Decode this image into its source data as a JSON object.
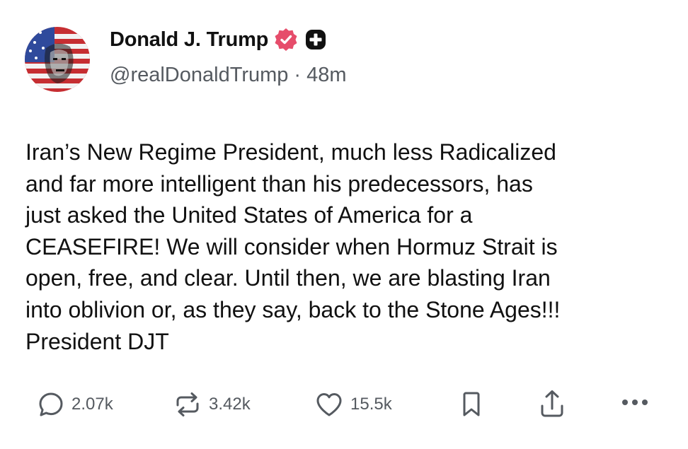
{
  "author": {
    "display_name": "Donald J. Trump",
    "handle": "@realDonaldTrump",
    "separator": "·",
    "time_ago": "48m",
    "verified_badge_icon": "verified-check-badge",
    "plus_badge_icon": "plus-badge"
  },
  "post": {
    "text": "Iran’s New Regime President, much less Radicalized\nand far more intelligent than his predecessors, has\njust asked the United States of America for a\nCEASEFIRE! We will consider when Hormuz Strait is\nopen, free, and clear. Until then, we are blasting Iran\ninto oblivion or, as they say, back to the Stone Ages!!!\nPresident DJT"
  },
  "actions": {
    "replies": {
      "icon": "reply-bubble-icon",
      "count": "2.07k"
    },
    "reposts": {
      "icon": "repost-icon",
      "count": "3.42k"
    },
    "likes": {
      "icon": "heart-icon",
      "count": "15.5k"
    },
    "bookmark": {
      "icon": "bookmark-icon"
    },
    "share": {
      "icon": "share-icon"
    },
    "more": {
      "icon": "more-icon"
    }
  },
  "colors": {
    "text": "#111111",
    "muted": "#555a60",
    "verified_badge": "#e64d6b",
    "plus_badge": "#111111",
    "background": "#ffffff"
  }
}
